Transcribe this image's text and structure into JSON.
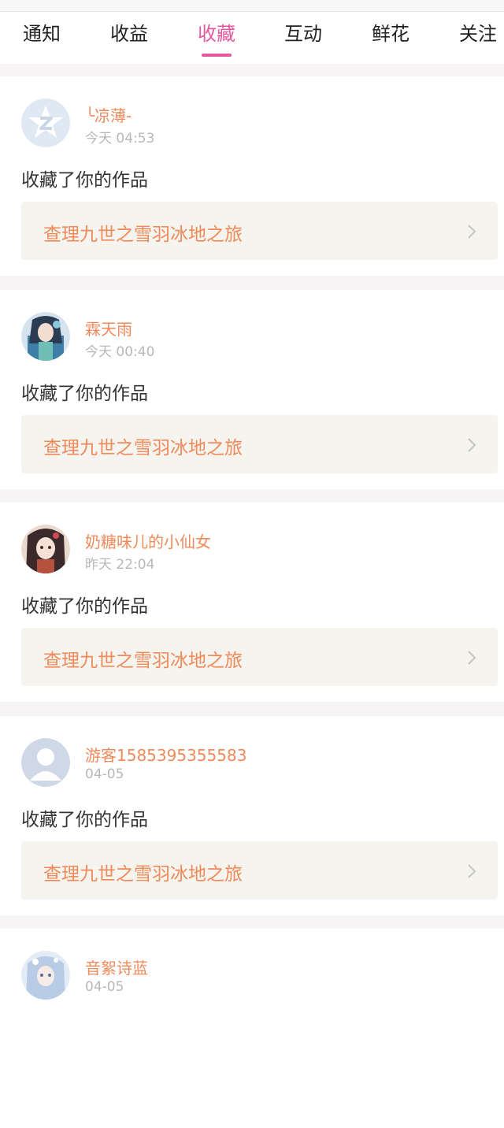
{
  "tabs": [
    {
      "label": "通知",
      "active": false
    },
    {
      "label": "收益",
      "active": false
    },
    {
      "label": "收藏",
      "active": true
    },
    {
      "label": "互动",
      "active": false
    },
    {
      "label": "鲜花",
      "active": false
    },
    {
      "label": "关注",
      "active": false
    }
  ],
  "colors": {
    "accent": "#e6589e",
    "username": "#f08a5a",
    "work_title": "#f08a5a",
    "meta": "#b8b8b8",
    "card_bg": "#f5f4ef",
    "page_bg": "#f6f4f5"
  },
  "feed": [
    {
      "username": "╰凉薄-",
      "time": "今天 04:53",
      "action": "收藏了你的作品",
      "work": "查理九世之雪羽冰地之旅",
      "avatar_icon": "qzone-star-icon"
    },
    {
      "username": "霖天雨",
      "time": "今天 00:40",
      "action": "收藏了你的作品",
      "work": "查理九世之雪羽冰地之旅",
      "avatar_icon": "anime-avatar-icon"
    },
    {
      "username": "奶糖味儿的小仙女",
      "time": "昨天 22:04",
      "action": "收藏了你的作品",
      "work": "查理九世之雪羽冰地之旅",
      "avatar_icon": "anime-avatar-icon"
    },
    {
      "username": "游客1585395355583",
      "time": "04-05",
      "action": "收藏了你的作品",
      "work": "查理九世之雪羽冰地之旅",
      "avatar_icon": "default-user-icon"
    },
    {
      "username": "音絮诗蓝",
      "time": "04-05",
      "action": "",
      "work": "",
      "avatar_icon": "anime-avatar-icon"
    }
  ]
}
